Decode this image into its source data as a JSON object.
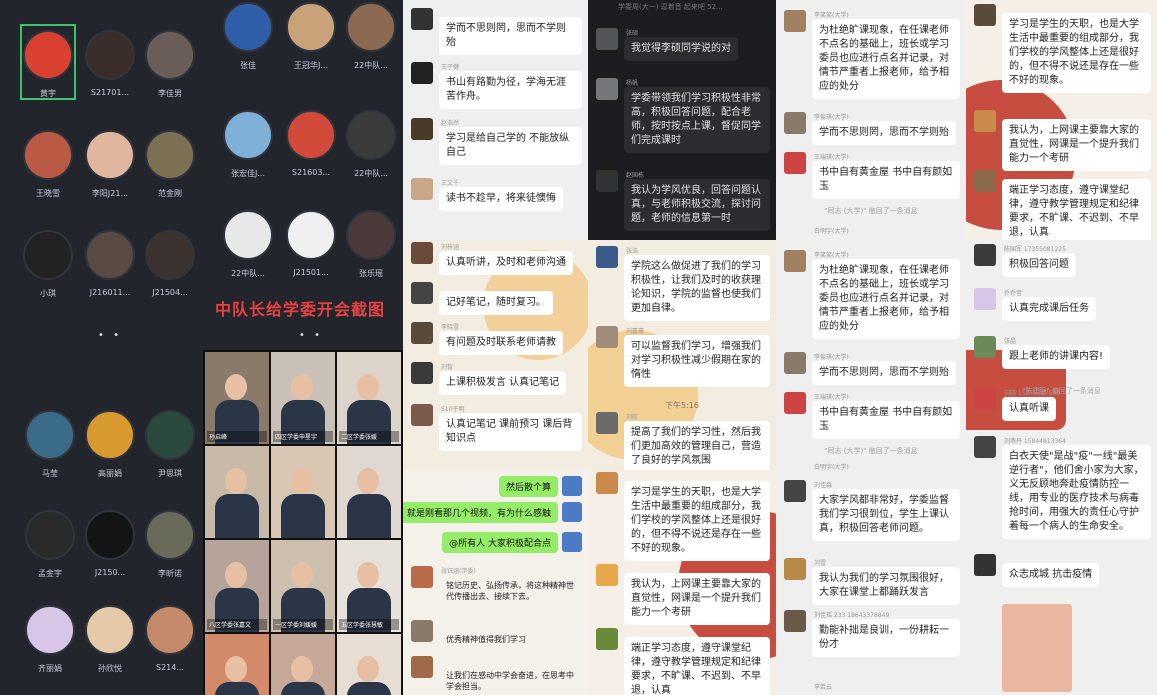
{
  "meeting1": {
    "participants": [
      {
        "name": "黄宇",
        "color": "#d9402f"
      },
      {
        "name": "S21701...",
        "color": "#3b2e2a"
      },
      {
        "name": "李佳男",
        "color": "#6b5d57"
      },
      {
        "name": "王晓雪",
        "color": "#b95a45"
      },
      {
        "name": "李阳J21...",
        "color": "#e0b79e"
      },
      {
        "name": "范金刚",
        "color": "#7d7154"
      },
      {
        "name": "小琪",
        "color": "#222"
      },
      {
        "name": "J216011...",
        "color": "#5a4a44"
      },
      {
        "name": "J21504...",
        "color": "#3a332f"
      }
    ],
    "dots": "• •"
  },
  "meeting2": {
    "participants": [
      {
        "name": "张佳",
        "color": "#2f5fa8"
      },
      {
        "name": "王冠华J...",
        "color": "#caa27a"
      },
      {
        "name": "22中队...",
        "color": "#8c6a52"
      },
      {
        "name": "张宏佳J...",
        "color": "#7fb0d8"
      },
      {
        "name": "S21603...",
        "color": "#d14a3a"
      },
      {
        "name": "22中队...",
        "color": "#3b3b3b"
      },
      {
        "name": "22中队...",
        "color": "#e8e8e8"
      },
      {
        "name": "J21501...",
        "color": "#f0f0f0"
      },
      {
        "name": "张乐瑶",
        "color": "#4a3a3a"
      }
    ],
    "banner": "中队长给学委开会截图",
    "dots": "• •"
  },
  "meeting3": {
    "participants": [
      {
        "name": "马莹",
        "color": "#3a6c8a"
      },
      {
        "name": "高丽娟",
        "color": "#d89a2e"
      },
      {
        "name": "尹思琪",
        "color": "#2a4a3e"
      },
      {
        "name": "孟金宇",
        "color": "#2a2a2a"
      },
      {
        "name": "J2150...",
        "color": "#141414"
      },
      {
        "name": "李昕诺",
        "color": "#6a6a5a"
      },
      {
        "name": "齐丽娟",
        "color": "#d8c6e8"
      },
      {
        "name": "孙欣悦",
        "color": "#e6c9a8"
      },
      {
        "name": "S214...",
        "color": "#c48a6a"
      }
    ]
  },
  "videos": [
    {
      "label": "孙启峰",
      "bg": "#8a7a6a"
    },
    {
      "label": "四区学委申星宇",
      "bg": "#c9c1b8"
    },
    {
      "label": "二区学委张媛",
      "bg": "#dcd4ca"
    },
    {
      "label": "",
      "bg": "#c7b9a8"
    },
    {
      "label": "",
      "bg": "#d9c6b2"
    },
    {
      "label": "",
      "bg": "#e0d8d0"
    },
    {
      "label": "八区学委张嘉文",
      "bg": "#b6a49a"
    },
    {
      "label": "一区学委刘媛媛",
      "bg": "#ccbfae"
    },
    {
      "label": "五区学委张慧敏",
      "bg": "#e6e1da"
    },
    {
      "label": "",
      "bg": "#d38a6a"
    },
    {
      "label": "",
      "bg": "#c6a898"
    },
    {
      "label": "",
      "bg": "#e6ded2"
    }
  ],
  "chat_a": {
    "messages": [
      {
        "name": "",
        "text": "学而不思则罔，思而不学则殆"
      },
      {
        "name": "王子健",
        "text": "书山有路勤为径，学海无涯苦作舟。"
      },
      {
        "name": "赵浩然",
        "text": "学习是给自己学的 不能放纵自己"
      },
      {
        "name": "王文千",
        "text": "读书不趁早，将来徒懊悔"
      }
    ]
  },
  "chat_b": {
    "top_preview": "学委周(大一) 逗着音 起来吧 52...",
    "messages": [
      {
        "name": "张硕",
        "text": "我觉得李硕同学说的对"
      },
      {
        "name": "杨帆",
        "text": "学委带领我们学习积极性非常高，积极回答问题，配合老师，按时按点上课，督促同学们完成课时"
      },
      {
        "name": "赵国栋",
        "text": "我认为学风优良，回答问题认真，与老师积极交流，探讨问题，老师的信息第一时"
      }
    ]
  },
  "chat_c": {
    "messages": [
      {
        "name": "刘梓涵",
        "text": "认真听讲，及时和老师沟通"
      },
      {
        "name": "",
        "text": "记好笔记，随时复习。"
      },
      {
        "name": "李晓雪",
        "text": "有问题及时联系老师请教"
      },
      {
        "name": "刘智",
        "text": "上课积极发言 认真记笔记"
      },
      {
        "name": "S10于明",
        "text": "认真记笔记 课前预习 课后背知识点"
      }
    ]
  },
  "chat_d": {
    "messages": [
      {
        "name": "张浩",
        "text": "学院这么做促进了我们的学习积极性，让我们及时的收获理论知识，学院的监督也使我们更加自律。"
      },
      {
        "name": "刘嘉豪",
        "text": "可以监督我们学习，增强我们对学习积极性减少假期在家的惰性"
      },
      {
        "name": "刘航",
        "text": "提高了我们的学习性，然后我们更加高效的管理自己，营造了良好的学风氛围"
      }
    ],
    "time": "下午5:16"
  },
  "chat_e": {
    "green": [
      "然后散个算",
      "就是刚看那几个视频，有为什么感触",
      "@所有人 大家积极配合点"
    ],
    "messages": [
      {
        "name": "张钰涵(学委)",
        "text": "铭记历史、弘扬传承，将这种精神世代传播出去、接续下去。"
      },
      {
        "name": "",
        "text": "优秀精神值得我们学习"
      },
      {
        "name": "",
        "text": "让我们在感动中学会奋进，在思考中学会担当。"
      }
    ]
  },
  "chat_f": {
    "messages": [
      {
        "name": "",
        "text": "学习是学生的天职，也是大学生活中最重要的组成部分，我们学校的学风整体上还是很好的，但不得不说还是存在一些不好的现象。"
      },
      {
        "name": "",
        "text": "我认为，上网课主要靠大家的直觉性，网课是一个提升我们能力一个考研"
      },
      {
        "name": "",
        "text": "端正学习态度，遵守课堂纪律，遵守教学管理规定和纪律要求，不旷课、不迟到、不早退，认真"
      }
    ]
  },
  "chat_g": {
    "messages": [
      {
        "name": "李笑笑(大学)",
        "text": "为杜绝旷课现象，在任课老师不点名的基础上，班长或学习委员也应进行点名并记录，对情节严重者上报老师，给予相应的处分"
      },
      {
        "name": "李俊琪(大学)",
        "text": "学而不思则罔，思而不学则殆"
      },
      {
        "name": "王瑞琪(大学)",
        "text": "书中自有黄金屋 书中自有颜如玉"
      }
    ],
    "sys": "\"同志 (大学)\" 撤回了一条消息",
    "sys_name": "白明宇(大学)"
  },
  "chat_h": {
    "messages": [
      {
        "name": "李笑笑(大学)",
        "text": "为杜绝旷课现象，在任课老师不点名的基础上，班长或学习委员也应进行点名并记录，对情节严重者上报老师，给予相应的处分"
      },
      {
        "name": "李俊琪(大学)",
        "text": "学而不思则罔，思而不学则殆"
      },
      {
        "name": "王瑞琪(大学)",
        "text": "书中自有黄金屋 书中自有颜如玉"
      }
    ],
    "sys": "\"同志 (大学)\" 撤回了一条消息",
    "sys_name": "白明宇(大学)"
  },
  "chat_i": {
    "messages": [
      {
        "name": "刘佳淼",
        "text": "大家学风都非常好，学委监督我们学习很到位，学生上课认真，积极回答老师问题。"
      },
      {
        "name": "刘雪",
        "text": "我认为我们的学习氛围很好，大家在课堂上都踊跃发言"
      },
      {
        "name": "刘佳瑶 233 18643378849",
        "text": "勤能补拙是良训，一份耕耘一份才"
      }
    ],
    "bottom_name": "李若云"
  },
  "chat_j": {
    "messages": [
      {
        "name": "",
        "text": "学习是学生的天职，也是大学生活中最重要的组成部分，我们学校的学风整体上还是很好的，但不得不说还是存在一些不好的现象。"
      },
      {
        "name": "",
        "text": "我认为，上网课主要靠大家的直觉性，网课是一个提升我们能力一个考研"
      },
      {
        "name": "",
        "text": "端正学习态度，遵守课堂纪律，遵守教学管理规定和纪律要求，不旷课、不迟到、不早退，认真"
      }
    ]
  },
  "chat_k": {
    "messages": [
      {
        "name": "陈国军 17355081225",
        "text": "积极回答问题"
      },
      {
        "name": "乔乔音",
        "text": "认真完成课后任务"
      },
      {
        "name": "张晶",
        "text": "跟上老师的讲课内容!"
      },
      {
        "name": "刘晓 15255317550",
        "text": "认真听课"
      },
      {
        "name": "刘燕丹 15844813364",
        "text": "白衣天使\"是战\"疫\"一线\"最美逆行者\"，他们舍小家为大家，义无反顾地奔赴疫情防控一线，用专业的医疗技术与病毒抢时间，用强大的责任心守护着每一个病人的生命安全。"
      },
      {
        "name": "",
        "text": "众志成城 抗击疫情"
      }
    ],
    "sys": "\"陈建强\" 撤回了一条消息"
  }
}
